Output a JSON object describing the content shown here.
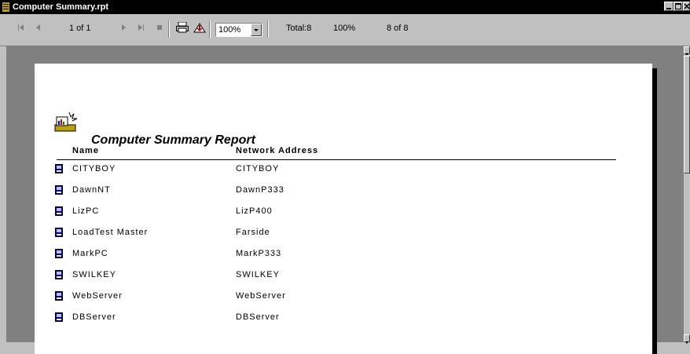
{
  "window": {
    "title": "Computer Summary.rpt"
  },
  "toolbar": {
    "page_indicator": "1 of 1",
    "zoom_value": "100%",
    "total": "Total:8",
    "percent": "100%",
    "records": "8 of 8"
  },
  "report": {
    "title": "Computer Summary Report",
    "columns": {
      "name": "Name",
      "network_address": "Network Address"
    },
    "rows": [
      {
        "name": "CITYBOY",
        "address": "CITYBOY"
      },
      {
        "name": "DawnNT",
        "address": "DawnP333"
      },
      {
        "name": "LizPC",
        "address": "LizP400"
      },
      {
        "name": "LoadTest Master",
        "address": "Farside"
      },
      {
        "name": "MarkPC",
        "address": "MarkP333"
      },
      {
        "name": "SWILKEY",
        "address": "SWILKEY"
      },
      {
        "name": "WebServer",
        "address": "WebServer"
      },
      {
        "name": "DBServer",
        "address": "DBServer"
      }
    ]
  },
  "colors": {
    "titlebar": "#000000",
    "viewport": "#808080",
    "page": "#ffffff",
    "chrome": "#c0c0c0"
  }
}
